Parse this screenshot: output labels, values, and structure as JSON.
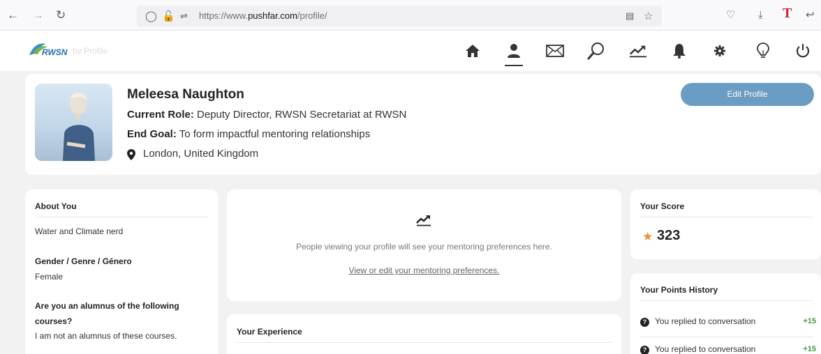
{
  "browser": {
    "url_prefix": "https://www.",
    "url_domain": "pushfar.com",
    "url_path": "/profile/"
  },
  "nav": {
    "logo_text": "RWSN",
    "logo_suffix": "by Profile",
    "icons": [
      "home-icon",
      "profile-icon",
      "messages-icon",
      "search-icon",
      "progress-icon",
      "notifications-icon",
      "settings-icon",
      "ideas-icon",
      "logout-icon"
    ],
    "active": "profile-icon"
  },
  "profile": {
    "name": "Meleesa Naughton",
    "role_label": "Current Role:",
    "role_value": "Deputy Director, RWSN Secretariat at RWSN",
    "goal_label": "End Goal:",
    "goal_value": "To form impactful mentoring relationships",
    "location": "London, United Kingdom",
    "edit_button": "Edit Profile",
    "accent_color": "#6a9cc4"
  },
  "about": {
    "title": "About You",
    "bio": "Water and Climate nerd",
    "gender_label": "Gender / Genre / Género",
    "gender_value": "Female",
    "alumnus_label_line1": "Are you an alumnus of the following",
    "alumnus_label_line2": "courses?",
    "alumnus_value": "I am not an alumnus of these courses."
  },
  "preferences": {
    "message": "People viewing your profile will see your mentoring preferences here.",
    "link": "View or edit your mentoring preferences",
    "link_suffix": "."
  },
  "experience": {
    "title": "Your Experience"
  },
  "score": {
    "title": "Your Score",
    "value": "323",
    "star_color": "#f08c2e"
  },
  "points_history": {
    "title": "Your Points History",
    "items": [
      {
        "text": "You replied to conversation",
        "points": "+15"
      },
      {
        "text": "You replied to conversation",
        "points": "+15"
      }
    ],
    "points_color": "#3d9a3d"
  }
}
